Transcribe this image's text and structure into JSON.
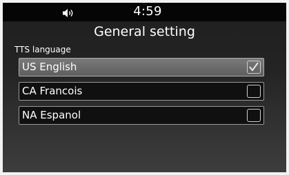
{
  "status_bar": {
    "volume_icon": "speaker-volume-icon",
    "time": "4:59"
  },
  "page": {
    "title": "General setting",
    "section_label": "TTS language"
  },
  "options": [
    {
      "label": "US English",
      "checked": true
    },
    {
      "label": "CA Francois",
      "checked": false
    },
    {
      "label": "NA Espanol",
      "checked": false
    }
  ]
}
